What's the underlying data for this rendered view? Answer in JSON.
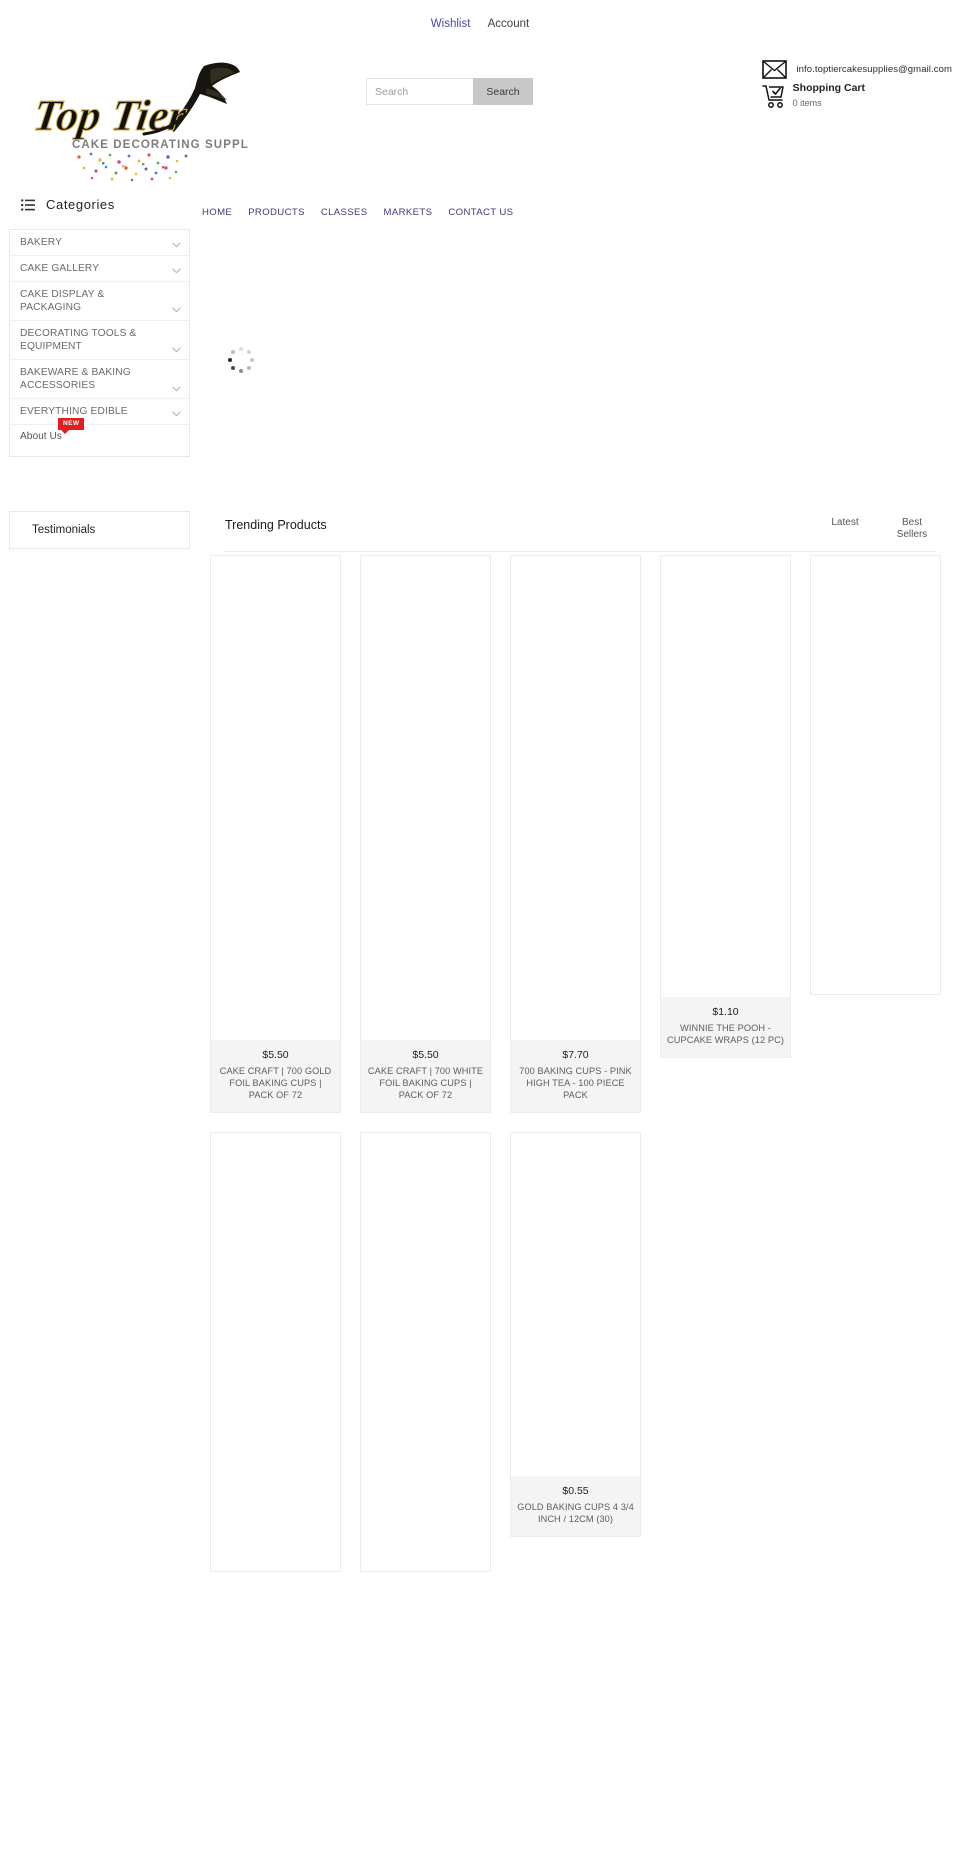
{
  "utility": {
    "wishlist": "Wishlist",
    "account": "Account"
  },
  "logo": {
    "brand_top": "Top Tier",
    "brand_sub": "CAKE DECORATING SUPPLIES",
    "alt": "Top Tier Cake Decorating Supplies"
  },
  "search": {
    "placeholder": "Search",
    "value": "",
    "button_label": "Search"
  },
  "contact": {
    "email": "info.toptiercakesupplies@gmail.com",
    "cart_title": "Shopping Cart",
    "cart_count": "0 items"
  },
  "sidebar": {
    "heading": "Categories",
    "items": [
      {
        "label": "BAKERY",
        "has_chevron": true
      },
      {
        "label": "CAKE GALLERY",
        "has_chevron": true
      },
      {
        "label": "CAKE DISPLAY & PACKAGING",
        "has_chevron": true
      },
      {
        "label": "DECORATING TOOLS & EQUIPMENT",
        "has_chevron": true
      },
      {
        "label": "BAKEWARE & BAKING ACCESSORIES",
        "has_chevron": true
      },
      {
        "label": "EVERYTHING EDIBLE",
        "has_chevron": true
      }
    ],
    "about": {
      "label": "About Us",
      "badge": "NEW"
    },
    "testimonials_title": "Testimonials"
  },
  "nav": {
    "items": [
      {
        "label": "HOME"
      },
      {
        "label": "PRODUCTS"
      },
      {
        "label": "CLASSES"
      },
      {
        "label": "MARKETS"
      },
      {
        "label": "CONTACT US"
      }
    ]
  },
  "trending": {
    "title": "Trending Products",
    "tab_latest": "Latest",
    "tab_best_sellers": "Best Sellers",
    "products": [
      {
        "price": "$5.50",
        "name": "CAKE CRAFT | 700 GOLD FOIL BAKING CUPS | PACK OF 72"
      },
      {
        "price": "$5.50",
        "name": "CAKE CRAFT | 700 WHITE FOIL BAKING CUPS | PACK OF 72"
      },
      {
        "price": "$7.70",
        "name": "700 BAKING CUPS - PINK HIGH TEA - 100 PIECE PACK"
      },
      {
        "price": "$1.10",
        "name": "WINNIE THE POOH - CUPCAKE WRAPS (12 PC)"
      },
      {
        "price": "",
        "name": ""
      },
      {
        "price": "",
        "name": ""
      },
      {
        "price": "",
        "name": ""
      },
      {
        "price": "$0.55",
        "name": "GOLD BAKING CUPS 4 3/4 INCH / 12CM (30)"
      }
    ]
  },
  "colors": {
    "link_blue": "#4a4aa8",
    "nav_navy": "#3c3c78",
    "badge_red": "#e02020",
    "search_button": "#c8c8c8",
    "card_info_bg": "#f4f4f4"
  }
}
